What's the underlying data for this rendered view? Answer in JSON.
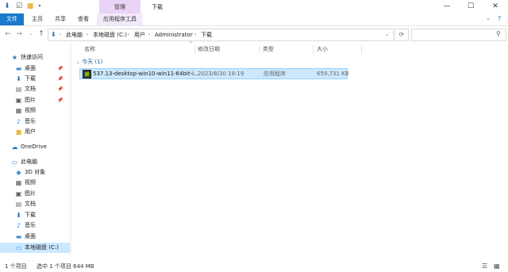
{
  "titlebar": {
    "manage_tab": "管理",
    "title": "下载",
    "qa_icons": [
      "download-arrow-icon",
      "properties-icon",
      "folder-icon",
      "dropdown-icon"
    ],
    "window_buttons": [
      "minimize",
      "maximize",
      "close"
    ]
  },
  "ribbon": {
    "file": "文件",
    "tabs": [
      "主页",
      "共享",
      "查看"
    ],
    "app_tools": "应用程序工具"
  },
  "address": {
    "crumbs": [
      "此电脑",
      "本地磁盘 (C:)",
      "用户",
      "Administrator",
      "下载"
    ]
  },
  "nav": {
    "quick_access": "快速访问",
    "quick_items": [
      "桌面",
      "下载",
      "文档",
      "图片",
      "视频",
      "音乐",
      "用户"
    ],
    "onedrive": "OneDrive",
    "this_pc": "此电脑",
    "pc_items": [
      "3D 对象",
      "视频",
      "图片",
      "文档",
      "下载",
      "音乐",
      "桌面",
      "本地磁盘 (C:)"
    ]
  },
  "columns": {
    "name": "名称",
    "modified": "修改日期",
    "type": "类型",
    "size": "大小"
  },
  "group": {
    "label": "今天 (1)"
  },
  "file": {
    "name": "537.13-desktop-win10-win11-64bit-i...",
    "modified": "2023/8/30 18:19",
    "type": "应用程序",
    "size": "659,731 KB"
  },
  "status": {
    "count": "1 个项目",
    "selected": "选中 1 个项目  644 MB"
  },
  "colors": {
    "accent": "#1979ca",
    "manage": "#e9d3f7",
    "selection": "#cce8ff"
  }
}
